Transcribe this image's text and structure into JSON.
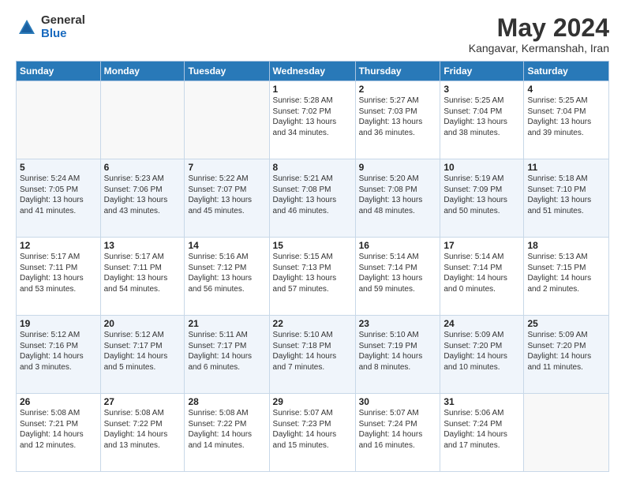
{
  "header": {
    "logo_general": "General",
    "logo_blue": "Blue",
    "title": "May 2024",
    "subtitle": "Kangavar, Kermanshah, Iran"
  },
  "weekdays": [
    "Sunday",
    "Monday",
    "Tuesday",
    "Wednesday",
    "Thursday",
    "Friday",
    "Saturday"
  ],
  "weeks": [
    [
      {
        "day": "",
        "info": ""
      },
      {
        "day": "",
        "info": ""
      },
      {
        "day": "",
        "info": ""
      },
      {
        "day": "1",
        "info": "Sunrise: 5:28 AM\nSunset: 7:02 PM\nDaylight: 13 hours\nand 34 minutes."
      },
      {
        "day": "2",
        "info": "Sunrise: 5:27 AM\nSunset: 7:03 PM\nDaylight: 13 hours\nand 36 minutes."
      },
      {
        "day": "3",
        "info": "Sunrise: 5:25 AM\nSunset: 7:04 PM\nDaylight: 13 hours\nand 38 minutes."
      },
      {
        "day": "4",
        "info": "Sunrise: 5:25 AM\nSunset: 7:04 PM\nDaylight: 13 hours\nand 39 minutes."
      }
    ],
    [
      {
        "day": "5",
        "info": "Sunrise: 5:24 AM\nSunset: 7:05 PM\nDaylight: 13 hours\nand 41 minutes."
      },
      {
        "day": "6",
        "info": "Sunrise: 5:23 AM\nSunset: 7:06 PM\nDaylight: 13 hours\nand 43 minutes."
      },
      {
        "day": "7",
        "info": "Sunrise: 5:22 AM\nSunset: 7:07 PM\nDaylight: 13 hours\nand 45 minutes."
      },
      {
        "day": "8",
        "info": "Sunrise: 5:21 AM\nSunset: 7:08 PM\nDaylight: 13 hours\nand 46 minutes."
      },
      {
        "day": "9",
        "info": "Sunrise: 5:20 AM\nSunset: 7:08 PM\nDaylight: 13 hours\nand 48 minutes."
      },
      {
        "day": "10",
        "info": "Sunrise: 5:19 AM\nSunset: 7:09 PM\nDaylight: 13 hours\nand 50 minutes."
      },
      {
        "day": "11",
        "info": "Sunrise: 5:18 AM\nSunset: 7:10 PM\nDaylight: 13 hours\nand 51 minutes."
      }
    ],
    [
      {
        "day": "12",
        "info": "Sunrise: 5:17 AM\nSunset: 7:11 PM\nDaylight: 13 hours\nand 53 minutes."
      },
      {
        "day": "13",
        "info": "Sunrise: 5:17 AM\nSunset: 7:11 PM\nDaylight: 13 hours\nand 54 minutes."
      },
      {
        "day": "14",
        "info": "Sunrise: 5:16 AM\nSunset: 7:12 PM\nDaylight: 13 hours\nand 56 minutes."
      },
      {
        "day": "15",
        "info": "Sunrise: 5:15 AM\nSunset: 7:13 PM\nDaylight: 13 hours\nand 57 minutes."
      },
      {
        "day": "16",
        "info": "Sunrise: 5:14 AM\nSunset: 7:14 PM\nDaylight: 13 hours\nand 59 minutes."
      },
      {
        "day": "17",
        "info": "Sunrise: 5:14 AM\nSunset: 7:14 PM\nDaylight: 14 hours\nand 0 minutes."
      },
      {
        "day": "18",
        "info": "Sunrise: 5:13 AM\nSunset: 7:15 PM\nDaylight: 14 hours\nand 2 minutes."
      }
    ],
    [
      {
        "day": "19",
        "info": "Sunrise: 5:12 AM\nSunset: 7:16 PM\nDaylight: 14 hours\nand 3 minutes."
      },
      {
        "day": "20",
        "info": "Sunrise: 5:12 AM\nSunset: 7:17 PM\nDaylight: 14 hours\nand 5 minutes."
      },
      {
        "day": "21",
        "info": "Sunrise: 5:11 AM\nSunset: 7:17 PM\nDaylight: 14 hours\nand 6 minutes."
      },
      {
        "day": "22",
        "info": "Sunrise: 5:10 AM\nSunset: 7:18 PM\nDaylight: 14 hours\nand 7 minutes."
      },
      {
        "day": "23",
        "info": "Sunrise: 5:10 AM\nSunset: 7:19 PM\nDaylight: 14 hours\nand 8 minutes."
      },
      {
        "day": "24",
        "info": "Sunrise: 5:09 AM\nSunset: 7:20 PM\nDaylight: 14 hours\nand 10 minutes."
      },
      {
        "day": "25",
        "info": "Sunrise: 5:09 AM\nSunset: 7:20 PM\nDaylight: 14 hours\nand 11 minutes."
      }
    ],
    [
      {
        "day": "26",
        "info": "Sunrise: 5:08 AM\nSunset: 7:21 PM\nDaylight: 14 hours\nand 12 minutes."
      },
      {
        "day": "27",
        "info": "Sunrise: 5:08 AM\nSunset: 7:22 PM\nDaylight: 14 hours\nand 13 minutes."
      },
      {
        "day": "28",
        "info": "Sunrise: 5:08 AM\nSunset: 7:22 PM\nDaylight: 14 hours\nand 14 minutes."
      },
      {
        "day": "29",
        "info": "Sunrise: 5:07 AM\nSunset: 7:23 PM\nDaylight: 14 hours\nand 15 minutes."
      },
      {
        "day": "30",
        "info": "Sunrise: 5:07 AM\nSunset: 7:24 PM\nDaylight: 14 hours\nand 16 minutes."
      },
      {
        "day": "31",
        "info": "Sunrise: 5:06 AM\nSunset: 7:24 PM\nDaylight: 14 hours\nand 17 minutes."
      },
      {
        "day": "",
        "info": ""
      }
    ]
  ]
}
